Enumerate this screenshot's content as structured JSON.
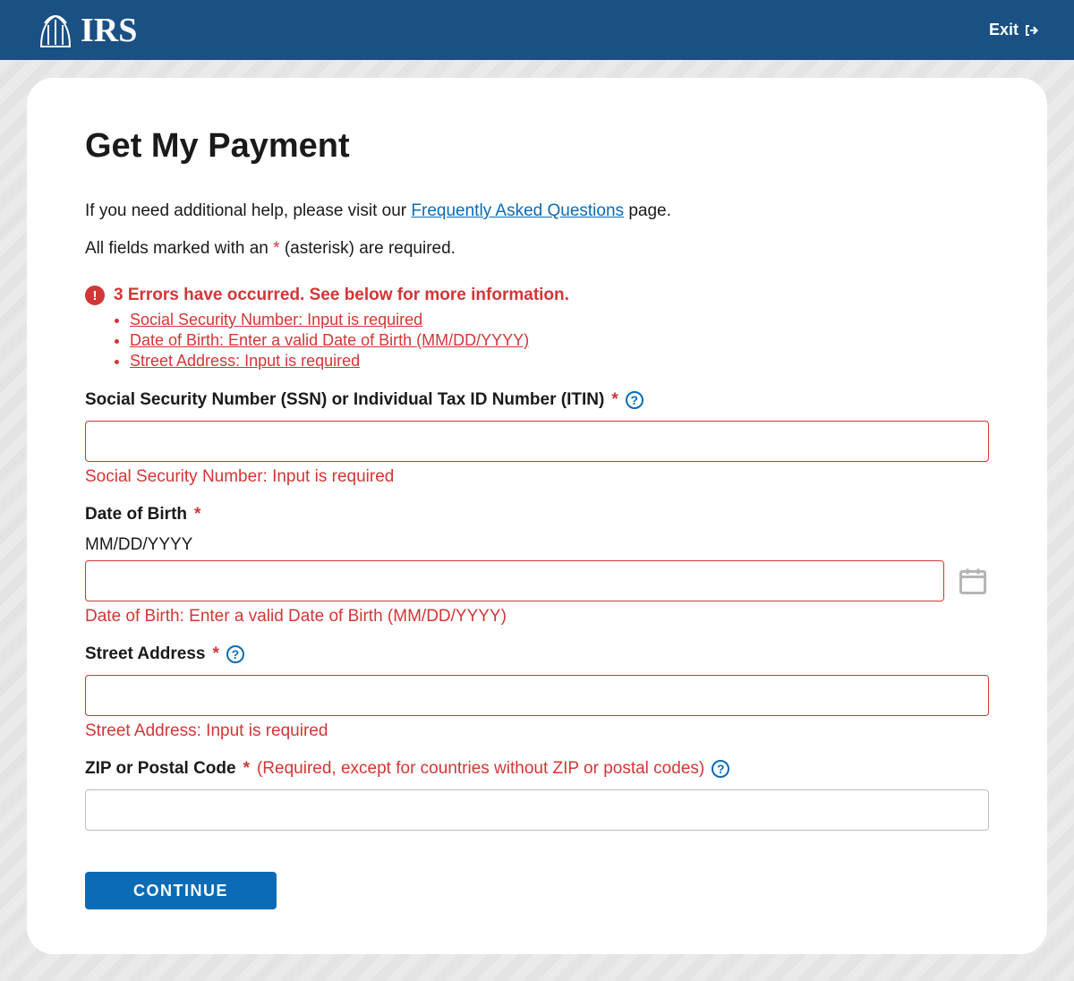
{
  "header": {
    "brand": "IRS",
    "exit_label": "Exit"
  },
  "page": {
    "title": "Get My Payment",
    "intro_prefix": "If you need additional help, please visit our ",
    "faq_link_text": "Frequently Asked Questions",
    "intro_suffix": " page.",
    "required_note_prefix": "All fields marked with an ",
    "required_note_mark": "*",
    "required_note_suffix": " (asterisk) are required."
  },
  "errors": {
    "summary_heading": "3 Errors have occurred. See below for more information.",
    "items": [
      "Social Security Number: Input is required",
      "Date of Birth: Enter a valid Date of Birth (MM/DD/YYYY)",
      "Street Address: Input is required"
    ]
  },
  "fields": {
    "ssn": {
      "label": "Social Security Number (SSN) or Individual Tax ID Number (ITIN)",
      "required_mark": "*",
      "value": "",
      "error": "Social Security Number: Input is required"
    },
    "dob": {
      "label": "Date of Birth",
      "required_mark": "*",
      "format_hint": "MM/DD/YYYY",
      "value": "",
      "error": "Date of Birth: Enter a valid Date of Birth (MM/DD/YYYY)"
    },
    "street": {
      "label": "Street Address",
      "required_mark": "*",
      "value": "",
      "error": "Street Address: Input is required"
    },
    "zip": {
      "label": "ZIP or Postal Code",
      "required_mark": "*",
      "note": "(Required, except for countries without ZIP or postal codes)",
      "value": ""
    }
  },
  "actions": {
    "continue_label": "CONTINUE"
  },
  "icons": {
    "help": "?",
    "alert": "!"
  }
}
